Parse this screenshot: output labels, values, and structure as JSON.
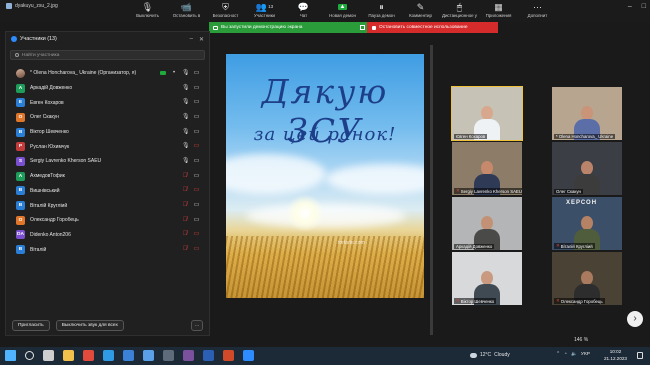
{
  "window": {
    "title": "dyakuyu_zsu_2.jpg"
  },
  "toolbar": {
    "items": [
      {
        "label": "Выключить",
        "icon": "microphone-icon",
        "glyph": "🎙"
      },
      {
        "label": "Остановить в",
        "icon": "video-camera-icon",
        "glyph": "📹"
      },
      {
        "label": "Безопасност",
        "icon": "shield-icon",
        "glyph": "⛨"
      },
      {
        "label": "Участники",
        "icon": "participants-icon",
        "glyph": "👥",
        "count": "13"
      },
      {
        "label": "Чат",
        "icon": "chat-icon",
        "glyph": "💬"
      },
      {
        "label": "Новая демон",
        "icon": "share-screen-icon",
        "glyph": "▲"
      },
      {
        "label": "Пауза демон",
        "icon": "pause-icon",
        "glyph": "⏸"
      },
      {
        "label": "Комментир",
        "icon": "annotate-icon",
        "glyph": "✎"
      },
      {
        "label": "Дистанционное у",
        "icon": "remote-control-icon",
        "glyph": "🖱"
      },
      {
        "label": "Приложения",
        "icon": "apps-icon",
        "glyph": "▦"
      },
      {
        "label": "Дополнит",
        "icon": "more-icon",
        "glyph": "⋯"
      }
    ]
  },
  "share_banner": {
    "sharing_text": "Вы запустили демонстрацию экрана",
    "stop_text": "Остановить совместное использование"
  },
  "participants_panel": {
    "title": "Участники (13)",
    "search_placeholder": "Найти участника",
    "participants": [
      {
        "name": "* Olena Honcharova_ Ukraine (Организатор, я)",
        "initial": "",
        "color": "#8a6a5a",
        "photo": true,
        "host": true,
        "mic_muted": false,
        "cam_off": false
      },
      {
        "name": "Аркадій Довженко",
        "initial": "А",
        "color": "#1d9c5a",
        "mic_muted": false,
        "cam_off": false
      },
      {
        "name": "Евген Кохаров",
        "initial": "Е",
        "color": "#2b7ed6",
        "mic_muted": false,
        "cam_off": false
      },
      {
        "name": "Олег Скакун",
        "initial": "О",
        "color": "#e0762a",
        "mic_muted": false,
        "cam_off": false
      },
      {
        "name": "Віктор Шевченко",
        "initial": "В",
        "color": "#2b7ed6",
        "mic_muted": false,
        "cam_off": false
      },
      {
        "name": "Руслан Юхимчук",
        "initial": "Р",
        "color": "#c43b3b",
        "mic_muted": false,
        "cam_off": true
      },
      {
        "name": "Sergiy Lavrenko Kherson SAEU",
        "initial": "S",
        "color": "#7a4fd0",
        "mic_muted": false,
        "cam_off": false
      },
      {
        "name": "АхмедовТофик",
        "initial": "А",
        "color": "#1d9c5a",
        "mic_muted": true,
        "cam_off": false
      },
      {
        "name": "Вишнівський",
        "initial": "В",
        "color": "#2b7ed6",
        "mic_muted": true,
        "cam_off": true
      },
      {
        "name": "Віталій Кругліий",
        "initial": "В",
        "color": "#2b7ed6",
        "mic_muted": true,
        "cam_off": false
      },
      {
        "name": "Олександр Горобець",
        "initial": "О",
        "color": "#e0762a",
        "mic_muted": true,
        "cam_off": false
      },
      {
        "name": "Didenko Anton206",
        "initial": "DA",
        "color": "#7a4fd0",
        "mic_muted": true,
        "cam_off": true
      },
      {
        "name": "Віталій",
        "initial": "В",
        "color": "#2b7ed6",
        "mic_muted": true,
        "cam_off": true
      }
    ],
    "invite_label": "Пригласить",
    "mute_all_label": "Выключить звук для всех",
    "more_label": "..."
  },
  "slide": {
    "line1": "Дякую ЗСУ",
    "line2": "за цей ранок!",
    "watermark": "tortarte.com"
  },
  "gallery": {
    "tiles": [
      {
        "name": "Євген Кохаров",
        "muted": false,
        "active": true,
        "bg": "#c7c2b6",
        "shirt": "#eef2f5",
        "skin": "#d8a88e"
      },
      {
        "name": "* Olena Honcharova_ Ukraine",
        "muted": false,
        "active": false,
        "bg": "#b8a58f",
        "shirt": "#5b6ea8",
        "skin": "#c99478"
      },
      {
        "name": "Sergiy Lavrenko Kherson SAEU",
        "muted": true,
        "active": false,
        "bg": "#8d7c67",
        "shirt": "#2f3a56",
        "skin": "#c7896c"
      },
      {
        "name": "Олег Скакун",
        "muted": false,
        "active": false,
        "bg": "#3b3f45",
        "shirt": "#3c3c3c",
        "skin": "#b98469"
      },
      {
        "name": "Аркадій Довженко",
        "muted": false,
        "active": false,
        "bg": "#b3b5b7",
        "shirt": "#4a4a48",
        "skin": "#c39276"
      },
      {
        "name": "Віталій Кругліий",
        "muted": true,
        "active": false,
        "bg": "#3c4f68",
        "shirt": "#4f5d3c",
        "skin": "#b58265"
      },
      {
        "name": "Віктор Шевченко",
        "muted": true,
        "active": false,
        "bg": "#d8d9db",
        "shirt": "#404a52",
        "skin": "#c99a80"
      },
      {
        "name": "Олександр Горобець",
        "muted": true,
        "active": false,
        "bg": "#4b4236",
        "shirt": "#2d2d2d",
        "skin": "#a97a5d"
      }
    ],
    "kherson_label": "ХЕРСОН"
  },
  "zoom_level": "146 %",
  "taskbar": {
    "weather_temp": "12°C",
    "weather_text": "Cloudy",
    "lang": "УКР",
    "time": "10:02",
    "date": "21.12.2023",
    "icons": [
      "windows-start-icon",
      "search-icon",
      "task-view-icon",
      "file-explorer-icon",
      "chrome-icon",
      "edge-icon",
      "mail-icon",
      "store-icon",
      "camera-icon",
      "viber-icon",
      "word-icon",
      "powerpoint-icon",
      "zoom-icon"
    ]
  }
}
